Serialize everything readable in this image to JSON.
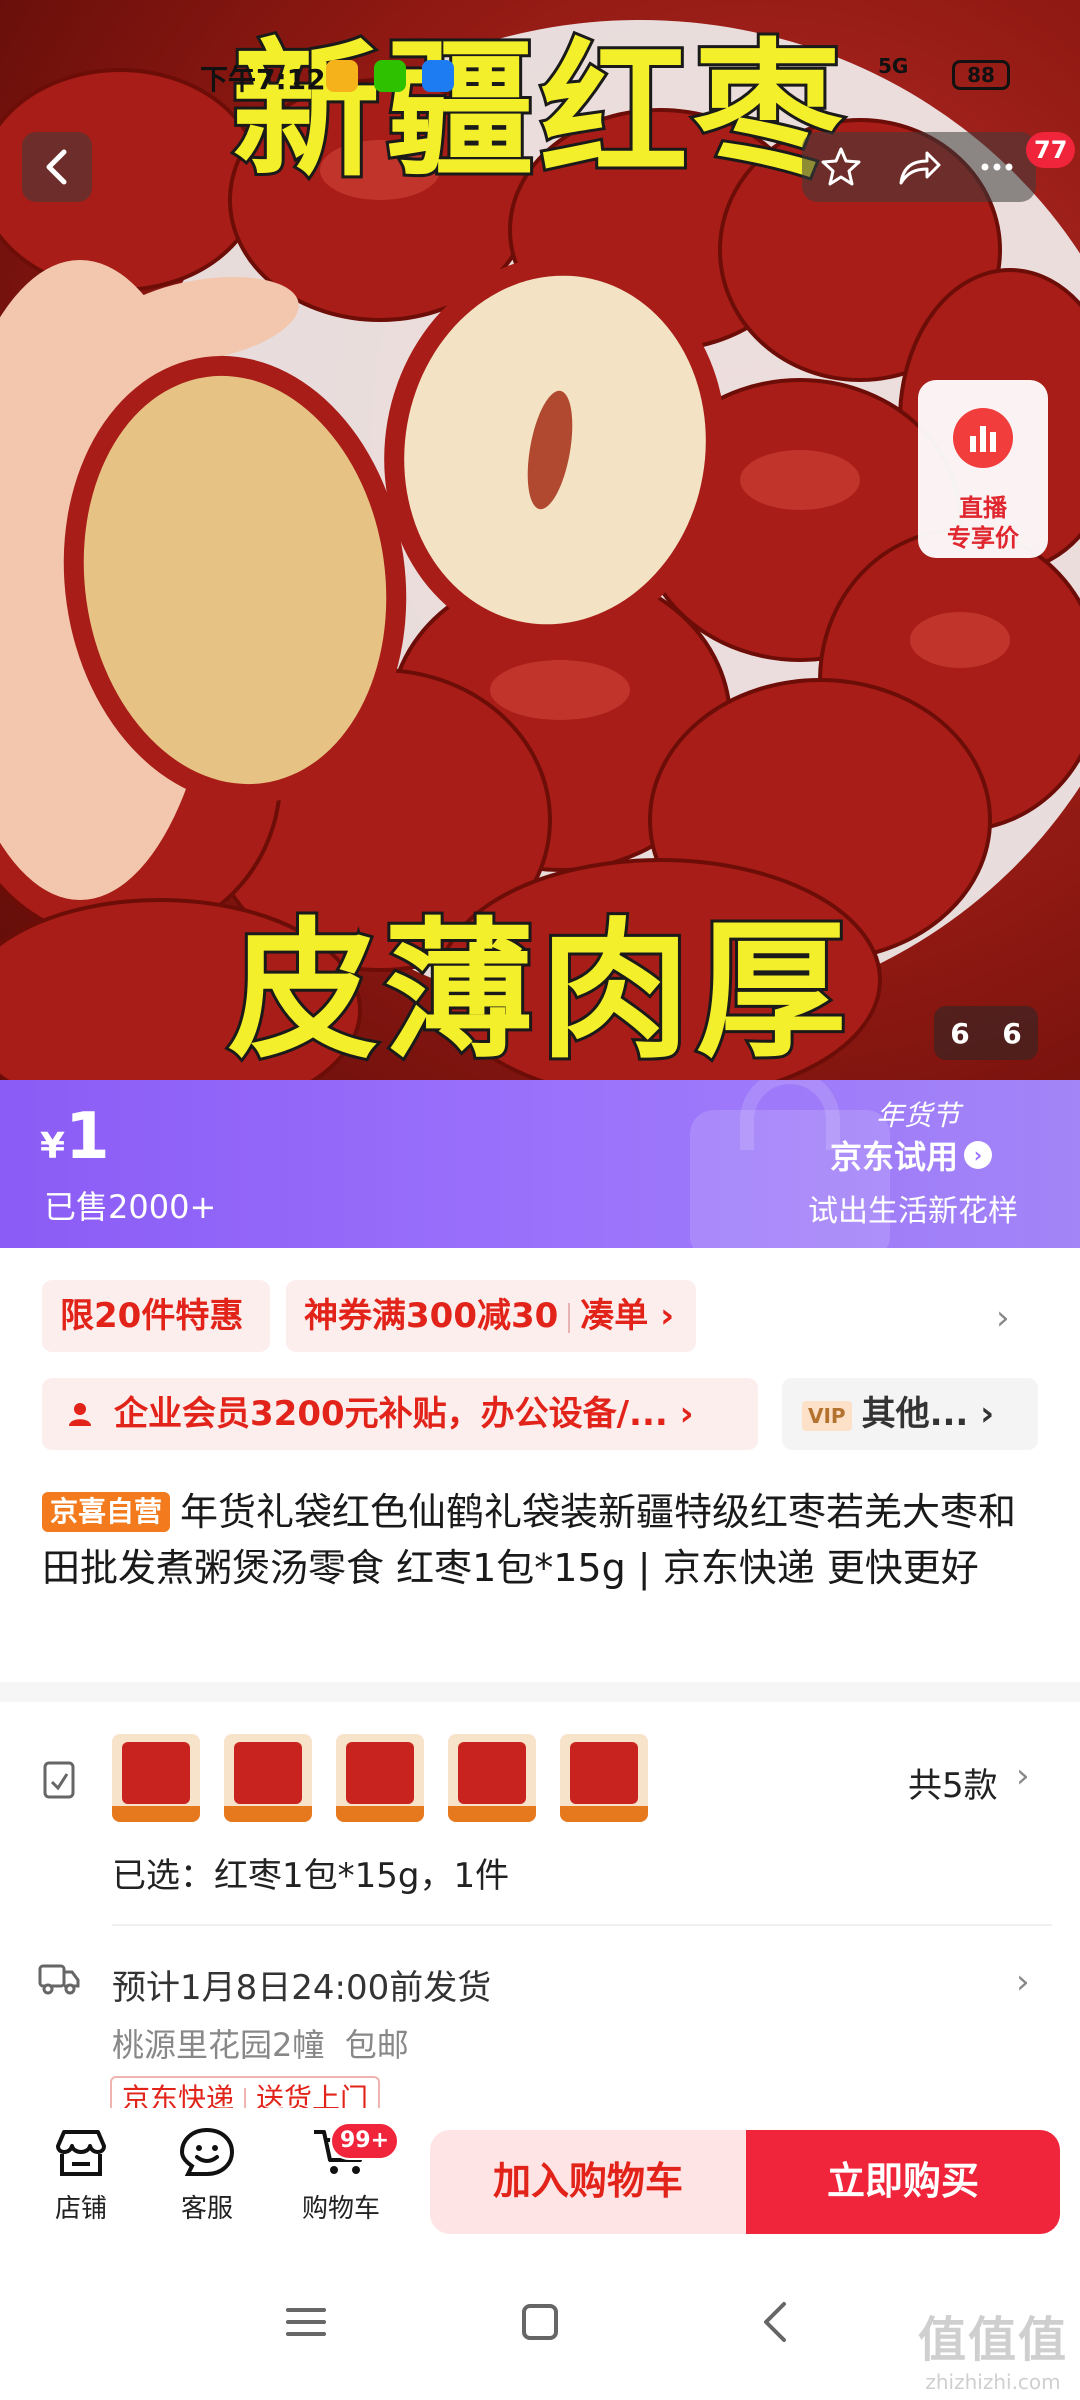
{
  "hero": {
    "title_top": "新疆红枣",
    "title_bottom": "皮薄肉厚",
    "counter_current": "6",
    "counter_total": "6",
    "more_badge": "77",
    "live_card": {
      "line1": "直播",
      "line2": "专享价"
    }
  },
  "status_bar": {
    "time": "下午7:12",
    "network": "5G",
    "battery": "88"
  },
  "price_banner": {
    "currency": "¥",
    "price": "1",
    "sold": "已售2000+",
    "festival_tag": "年货节",
    "trial_label": "京东试用",
    "trial_sub": "试出生活新花样"
  },
  "promos": {
    "limit": "限20件特惠",
    "coupon": "神券满300减30",
    "coupon_action": "凑单",
    "enterprise": "企业会员3200元补贴，办公设备/...",
    "vip_badge": "VIP",
    "vip_other": "其他..."
  },
  "product": {
    "badge": "京喜自营",
    "title": "年货礼袋红色仙鹤礼袋装新疆特级红枣若羌大枣和田批发煮粥煲汤零食 红枣1包*15g | 京东快递 更快更好"
  },
  "variants": {
    "count": "共5款",
    "selected": "已选：红枣1包*15g，1件"
  },
  "shipping": {
    "time": "预计1月8日24:00前发货",
    "address": "桃源里花园2幢",
    "free_shipping": "包邮",
    "tag1": "京东快递",
    "tag2": "送货上门"
  },
  "action_bar": {
    "store": "店铺",
    "service": "客服",
    "cart": "购物车",
    "cart_badge": "99+",
    "add_to_cart": "加入购物车",
    "buy_now": "立即购买"
  },
  "watermark": {
    "logo": "值值值",
    "site": "zhizhizhi.com"
  },
  "colors": {
    "accent": "#f0243a",
    "price_banner": "#9b73fb",
    "self_badge": "#f37b1d"
  }
}
